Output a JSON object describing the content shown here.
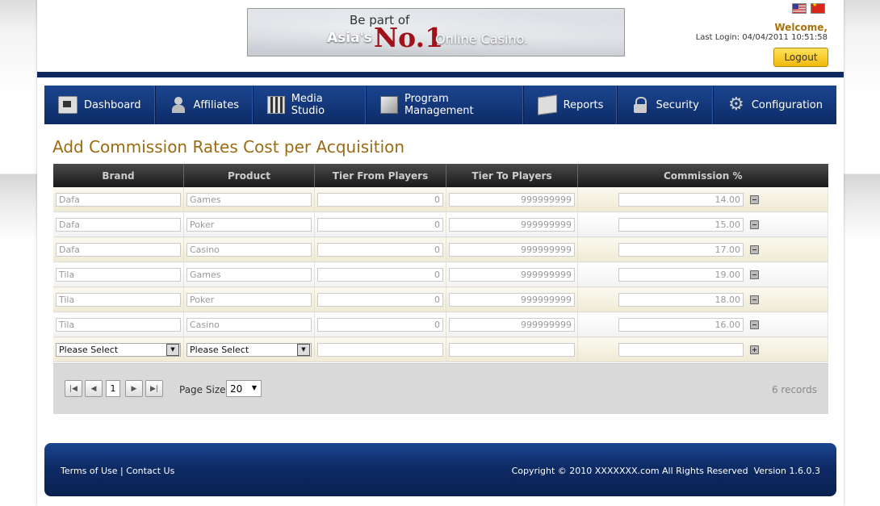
{
  "header": {
    "banner": {
      "line1": "Be part of",
      "asia": "Asia's",
      "no1": "No.1",
      "casino": "Online Casino."
    },
    "welcome": "Welcome,",
    "last_login": "Last Login: 04/04/2011 10:51:58",
    "logout": "Logout"
  },
  "nav": {
    "items": [
      {
        "label": "Dashboard",
        "icon": "dashboard-icon"
      },
      {
        "label": "Affiliates",
        "icon": "user-icon"
      },
      {
        "label": "Media Studio",
        "icon": "clapperboard-icon"
      },
      {
        "label": "Program Management",
        "icon": "chart-icon"
      },
      {
        "label": "Reports",
        "icon": "report-icon"
      },
      {
        "label": "Security",
        "icon": "lock-icon"
      },
      {
        "label": "Configuration",
        "icon": "gear-icon"
      }
    ]
  },
  "page_title": "Add Commission Rates Cost per Acquisition",
  "table": {
    "headers": [
      "Brand",
      "Product",
      "Tier From Players",
      "Tier To Players",
      "Commission %"
    ],
    "rows": [
      {
        "brand": "Dafa",
        "product": "Games",
        "from": "0",
        "to": "999999999",
        "commission": "14.00"
      },
      {
        "brand": "Dafa",
        "product": "Poker",
        "from": "0",
        "to": "999999999",
        "commission": "15.00"
      },
      {
        "brand": "Dafa",
        "product": "Casino",
        "from": "0",
        "to": "999999999",
        "commission": "17.00"
      },
      {
        "brand": "Tila",
        "product": "Games",
        "from": "0",
        "to": "999999999",
        "commission": "19.00"
      },
      {
        "brand": "Tila",
        "product": "Poker",
        "from": "0",
        "to": "999999999",
        "commission": "18.00"
      },
      {
        "brand": "Tila",
        "product": "Casino",
        "from": "0",
        "to": "999999999",
        "commission": "16.00"
      }
    ],
    "new_row": {
      "brand_select": "Please Select",
      "product_select": "Please Select"
    }
  },
  "pager": {
    "current_page": "1",
    "page_size_label": "Page Size",
    "page_size": "20",
    "records": "6 records"
  },
  "footer": {
    "terms": "Terms of Use",
    "separator": "|",
    "contact": "Contact Us",
    "copyright": "Copyright © 2010 XXXXXXX.com All Rights Reserved",
    "version": "Version 1.6.0.3"
  }
}
